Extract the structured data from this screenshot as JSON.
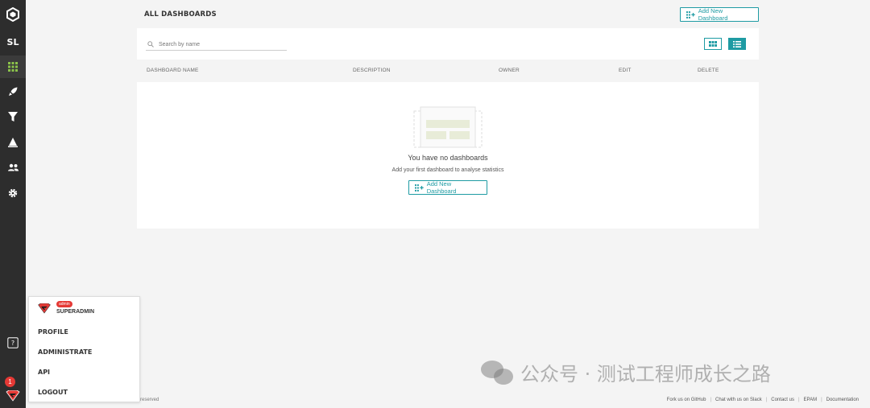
{
  "sidebar": {
    "project_initials": "SL",
    "notification_count": "1"
  },
  "main": {
    "title": "ALL DASHBOARDS",
    "add_button_label": "Add New Dashboard",
    "search_placeholder": "Search by name",
    "columns": [
      "DASHBOARD NAME",
      "DESCRIPTION",
      "OWNER",
      "EDIT",
      "DELETE"
    ],
    "empty_title": "You have no dashboards",
    "empty_subtitle": "Add your first dashboard to analyse statistics",
    "empty_button_label": "Add New Dashboard"
  },
  "user_menu": {
    "role_badge": "admin",
    "username": "SUPERADMIN",
    "items": [
      "PROFILE",
      "ADMINISTRATE",
      "API",
      "LOGOUT"
    ]
  },
  "footer": {
    "copyright": "reserved",
    "links": [
      "Fork us on GitHub",
      "Chat with us on Slack",
      "Contact us",
      "EPAM",
      "Documentation"
    ]
  },
  "watermark": {
    "text": "公众号 · 测试工程师成长之路"
  },
  "colors": {
    "accent": "#1e9ba3",
    "sidebar_bg": "#2d2d2d",
    "active_icon": "#8bc34a",
    "badge": "#e53935"
  }
}
